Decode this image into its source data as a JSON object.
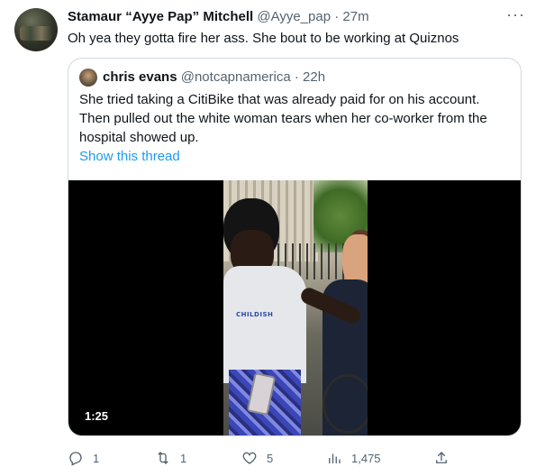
{
  "tweet": {
    "author_name": "Stamaur “Ayye Pap” Mitchell",
    "author_handle": "@Ayye_pap",
    "separator": "·",
    "time": "27m",
    "more_label": "···",
    "text": "Oh yea they gotta fire her ass. She bout to be working at Quiznos"
  },
  "quoted_tweet": {
    "author_name": "chris evans",
    "author_handle": "@notcapnamerica",
    "separator": "·",
    "time": "22h",
    "text": "She tried taking a CitiBike that was already paid for on his account. Then pulled out the white woman tears when her co-worker from the hospital showed up.",
    "show_thread_label": "Show this thread",
    "video": {
      "duration": "1:25",
      "shirt_logo_text": "CHILDISH"
    }
  },
  "actions": {
    "reply": {
      "icon": "reply-icon",
      "count": "1"
    },
    "retweet": {
      "icon": "retweet-icon",
      "count": "1"
    },
    "like": {
      "icon": "heart-icon",
      "count": "5"
    },
    "views": {
      "icon": "views-icon",
      "count": "1,475"
    },
    "share": {
      "icon": "share-icon"
    }
  },
  "colors": {
    "text_primary": "#0f1419",
    "text_secondary": "#536471",
    "link": "#1d9bf0",
    "border": "#cfd9de"
  }
}
